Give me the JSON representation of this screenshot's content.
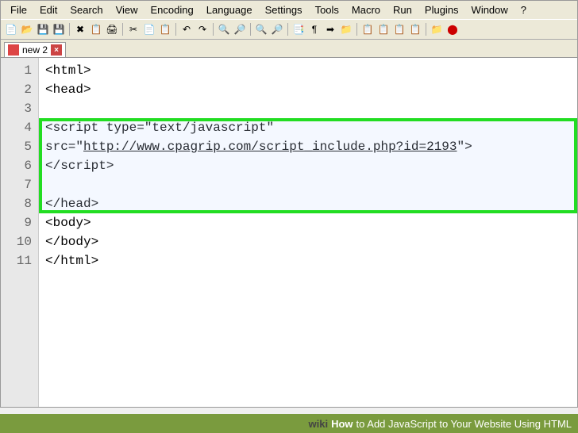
{
  "menubar": [
    "File",
    "Edit",
    "Search",
    "View",
    "Encoding",
    "Language",
    "Settings",
    "Tools",
    "Macro",
    "Run",
    "Plugins",
    "Window",
    "?"
  ],
  "tab": {
    "label": "new 2",
    "close": "×"
  },
  "code": {
    "lines": [
      {
        "n": 1,
        "t": "<html>"
      },
      {
        "n": 2,
        "t": "<head>"
      },
      {
        "n": 3,
        "t": ""
      },
      {
        "n": 4,
        "t": "<script type=\"text/javascript\""
      },
      {
        "n": 5,
        "t": "src=\"",
        "url": "http://www.cpagrip.com/script_include.php?id=2193",
        "after": "\">"
      },
      {
        "n": 6,
        "t": "</script>"
      },
      {
        "n": 7,
        "t": ""
      },
      {
        "n": 8,
        "t": "</head>"
      },
      {
        "n": 9,
        "t": "<body>"
      },
      {
        "n": 10,
        "t": "</body>"
      },
      {
        "n": 11,
        "t": "</html>"
      }
    ]
  },
  "footer": {
    "brand": "wiki",
    "how": "How",
    "title": "to Add JavaScript to Your Website Using HTML"
  }
}
